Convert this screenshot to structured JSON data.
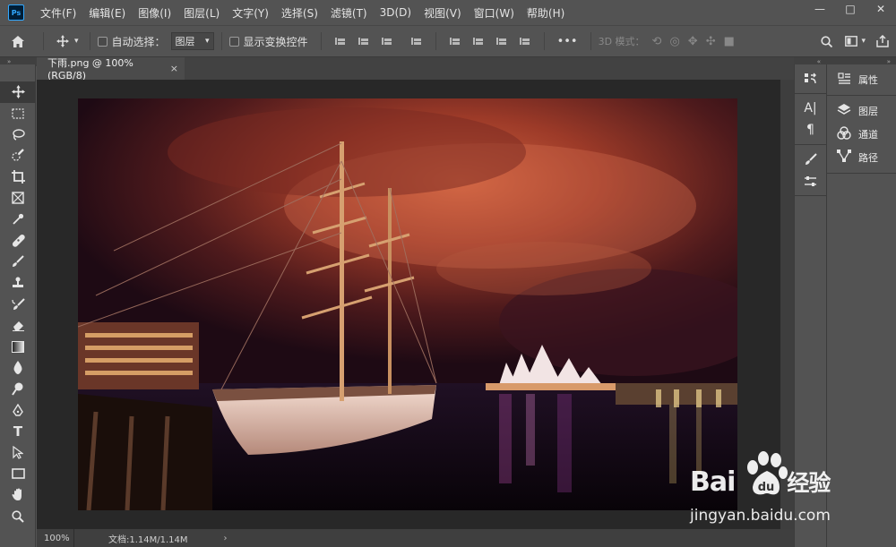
{
  "app": {
    "logo_text": "Ps"
  },
  "menu": [
    "文件(F)",
    "编辑(E)",
    "图像(I)",
    "图层(L)",
    "文字(Y)",
    "选择(S)",
    "滤镜(T)",
    "3D(D)",
    "视图(V)",
    "窗口(W)",
    "帮助(H)"
  ],
  "window_controls": {
    "minimize": "—",
    "maximize": "□",
    "close": "✕"
  },
  "options": {
    "auto_select_label": "自动选择：",
    "layer_select_value": "图层",
    "show_transform_label": "显示变换控件",
    "more_label": "•••",
    "mode_3d_label": "3D 模式："
  },
  "document": {
    "tab_title": "下雨.png @ 100%(RGB/8)",
    "tab_close": "×",
    "zoom": "100%",
    "doc_info": "文档:1.14M/1.14M",
    "status_arrow": "›"
  },
  "panels": {
    "properties": "属性",
    "layers": "图层",
    "channels": "通道",
    "paths": "路径"
  },
  "watermark": {
    "logo_text": "Bai",
    "logo_tail": "经验",
    "url": "jingyan.baidu.com"
  },
  "colors": {
    "bg": "#535353",
    "canvas": "#282828",
    "accent": "#31a8ff"
  }
}
